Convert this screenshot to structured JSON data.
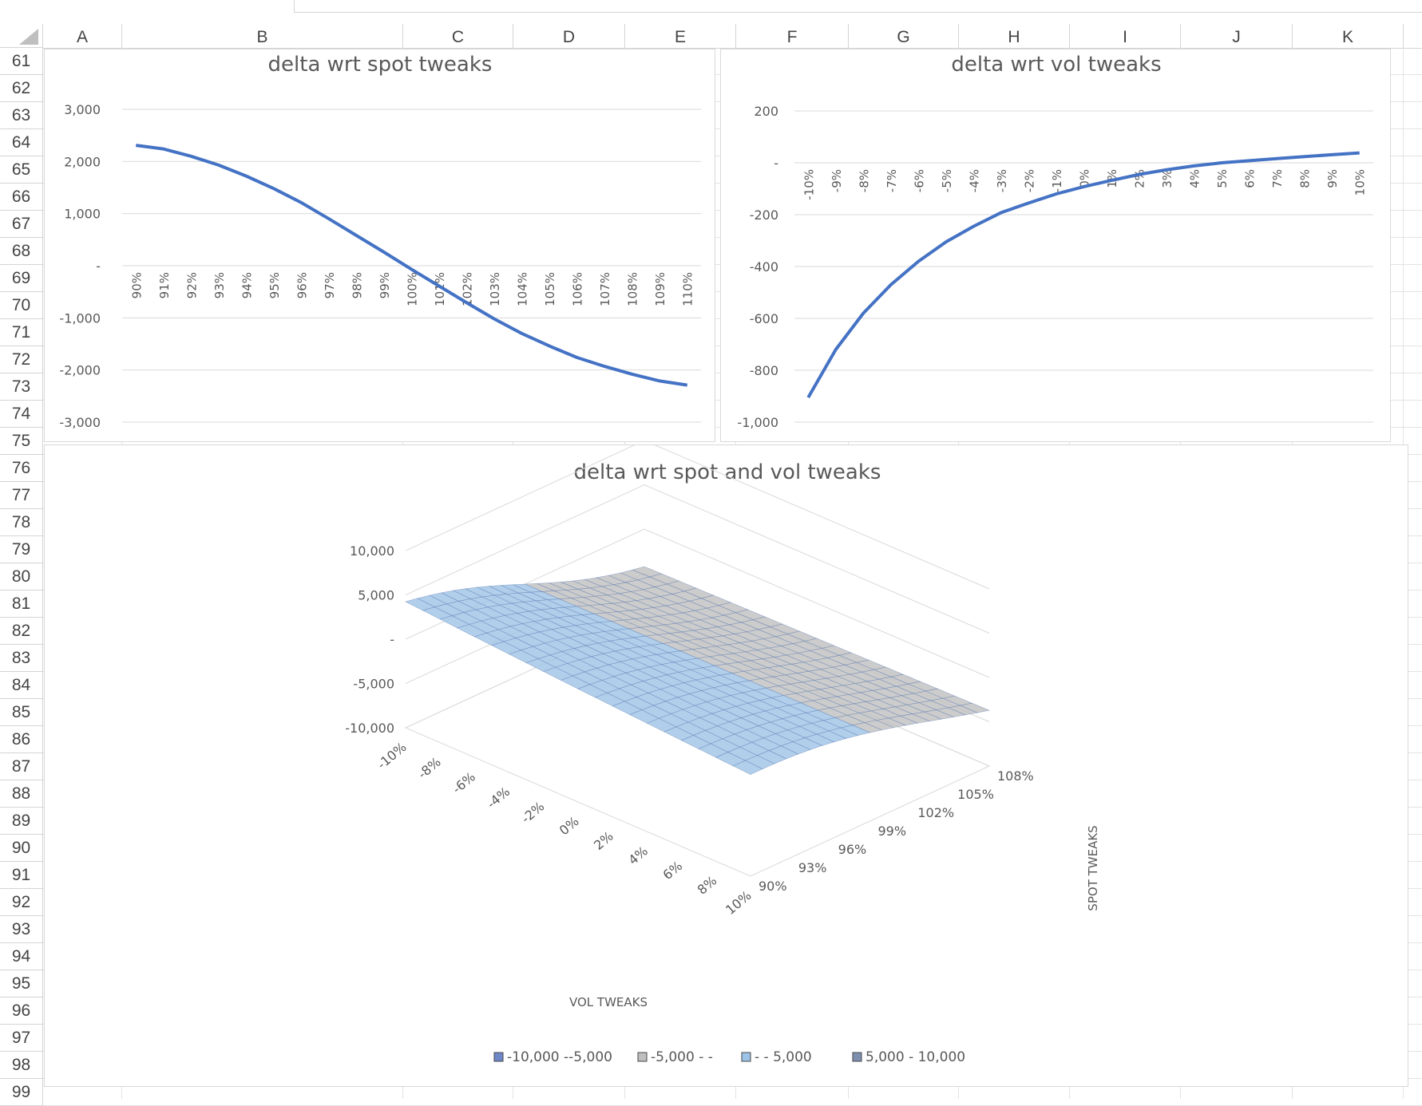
{
  "columns": [
    "A",
    "B",
    "C",
    "D",
    "E",
    "F",
    "G",
    "H",
    "I",
    "J",
    "K"
  ],
  "rows": [
    "61",
    "62",
    "63",
    "64",
    "65",
    "66",
    "67",
    "68",
    "69",
    "70",
    "71",
    "72",
    "73",
    "74",
    "75",
    "76",
    "77",
    "78",
    "79",
    "80",
    "81",
    "82",
    "83",
    "84",
    "85",
    "86",
    "87",
    "88",
    "89",
    "90",
    "91",
    "92",
    "93",
    "94",
    "95",
    "96",
    "97",
    "98",
    "99"
  ],
  "colors": {
    "line": "#4472c4",
    "grid": "#d9d9d9",
    "band_neg10_neg5": "#6f86c9",
    "band_neg5_0": "#bfbfbf",
    "band_0_5": "#9dc3e6",
    "band_5_10": "#7f8fb0"
  },
  "chart_data": [
    {
      "type": "line",
      "title": "delta wrt spot tweaks",
      "categories": [
        "90%",
        "91%",
        "92%",
        "93%",
        "94%",
        "95%",
        "96%",
        "97%",
        "98%",
        "99%",
        "100%",
        "101%",
        "102%",
        "103%",
        "104%",
        "105%",
        "106%",
        "107%",
        "108%",
        "109%",
        "110%"
      ],
      "series": [
        {
          "values": [
            2310,
            2240,
            2100,
            1930,
            1720,
            1480,
            1210,
            900,
            580,
            260,
            -70,
            -390,
            -710,
            -1020,
            -1300,
            -1540,
            -1760,
            -1930,
            -2080,
            -2210,
            -2290
          ]
        }
      ],
      "y_ticks": [
        "3,000",
        "2,000",
        "1,000",
        "-",
        "-1,000",
        "-2,000",
        "-3,000"
      ],
      "ylim": [
        -3000,
        3000
      ],
      "grid": true
    },
    {
      "type": "line",
      "title": "delta wrt vol tweaks",
      "categories": [
        "-10%",
        "-9%",
        "-8%",
        "-7%",
        "-6%",
        "-5%",
        "-4%",
        "-3%",
        "-2%",
        "-1%",
        "0%",
        "1%",
        "2%",
        "3%",
        "4%",
        "5%",
        "6%",
        "7%",
        "8%",
        "9%",
        "10%"
      ],
      "series": [
        {
          "values": [
            -905,
            -720,
            -580,
            -470,
            -380,
            -305,
            -245,
            -192,
            -155,
            -120,
            -92,
            -68,
            -45,
            -27,
            -12,
            0,
            8,
            16,
            24,
            31,
            38
          ]
        }
      ],
      "y_ticks": [
        "200",
        "-",
        "-200",
        "-400",
        "-600",
        "-800",
        "-1,000"
      ],
      "ylim": [
        -1000,
        200
      ],
      "grid": true
    },
    {
      "type": "surface",
      "title": "delta wrt spot and vol tweaks",
      "x_label": "VOL TWEAKS",
      "y_label": "SPOT TWEAKS",
      "x_ticks": [
        "-10%",
        "-8%",
        "-6%",
        "-4%",
        "-2%",
        "0%",
        "2%",
        "4%",
        "6%",
        "8%",
        "10%"
      ],
      "y_ticks": [
        "90%",
        "93%",
        "96%",
        "99%",
        "102%",
        "105%",
        "108%"
      ],
      "z_ticks": [
        "10,000",
        "5,000",
        "-",
        "-5,000",
        "-10,000"
      ],
      "legend": [
        "-10,000 --5,000",
        "-5,000 - -",
        "-  - 5,000",
        "5,000 - 10,000"
      ]
    }
  ]
}
